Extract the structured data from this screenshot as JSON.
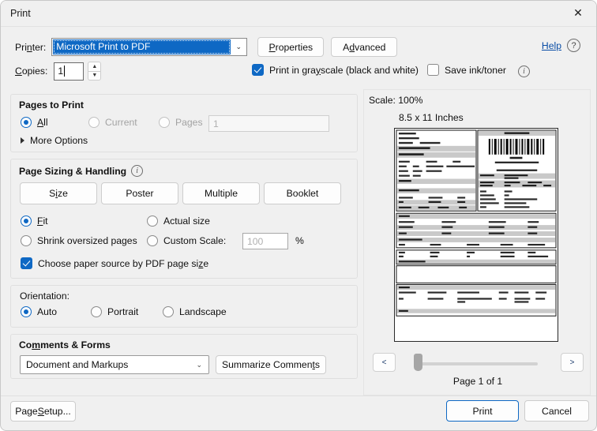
{
  "window": {
    "title": "Print",
    "close_icon": "close-icon"
  },
  "printer": {
    "label": "Printer:",
    "label_accel_pre": "Pri",
    "label_accel": "n",
    "label_accel_post": "ter:",
    "selected": "Microsoft Print to PDF",
    "dropdown_icon": "chevron-down-icon",
    "properties_button": "Properties",
    "properties_accel": "P",
    "advanced_button": "Advanced",
    "advanced_accel": "d",
    "help_link": "Help",
    "help_icon": "question-mark-icon"
  },
  "copies": {
    "label": "Copies:",
    "label_accel": "C",
    "value": "1",
    "spinner_up_icon": "triangle-up-icon",
    "spinner_down_icon": "triangle-down-icon"
  },
  "grayscale": {
    "label": "Print in grayscale (black and white)",
    "checked": true
  },
  "save_ink": {
    "label": "Save ink/toner",
    "checked": false,
    "info_icon": "info-circle-icon"
  },
  "pages_to_print": {
    "title": "Pages to Print",
    "options": [
      {
        "label": "All",
        "selected": true,
        "disabled": false
      },
      {
        "label": "Current",
        "selected": false,
        "disabled": true
      },
      {
        "label": "Pages",
        "selected": false,
        "disabled": true
      }
    ],
    "pages_value": "1",
    "more_options": "More Options",
    "more_options_icon": "triangle-right-icon"
  },
  "page_sizing": {
    "title": "Page Sizing & Handling",
    "info_icon": "info-circle-icon",
    "buttons": [
      {
        "label": "Size",
        "accel": "i"
      },
      {
        "label": "Poster",
        "accel": ""
      },
      {
        "label": "Multiple",
        "accel": ""
      },
      {
        "label": "Booklet",
        "accel": ""
      }
    ],
    "fit": {
      "label": "Fit",
      "accel": "F",
      "selected": true
    },
    "actual_size": {
      "label": "Actual size",
      "selected": false
    },
    "shrink": {
      "label": "Shrink oversized pages",
      "selected": false
    },
    "custom_scale": {
      "label": "Custom Scale:",
      "selected": false,
      "value": "100",
      "unit": "%"
    },
    "paper_source": {
      "label": "Choose paper source by PDF page size",
      "checked": true
    }
  },
  "orientation": {
    "title": "Orientation:",
    "options": [
      {
        "label": "Auto",
        "selected": true
      },
      {
        "label": "Portrait",
        "selected": false
      },
      {
        "label": "Landscape",
        "selected": false
      }
    ]
  },
  "comments_forms": {
    "title": "Comments & Forms",
    "selected": "Document and Markups",
    "dropdown_icon": "chevron-down-icon",
    "summarize_button": "Summarize Comments"
  },
  "preview": {
    "scale_text": "Scale: 100%",
    "dimensions_text": "8.5 x 11 Inches",
    "prev_button": "<",
    "next_button": ">",
    "page_indicator": "Page 1 of 1"
  },
  "footer": {
    "page_setup": "Page Setup...",
    "page_setup_accel": "S",
    "print_button": "Print",
    "cancel_button": "Cancel"
  }
}
